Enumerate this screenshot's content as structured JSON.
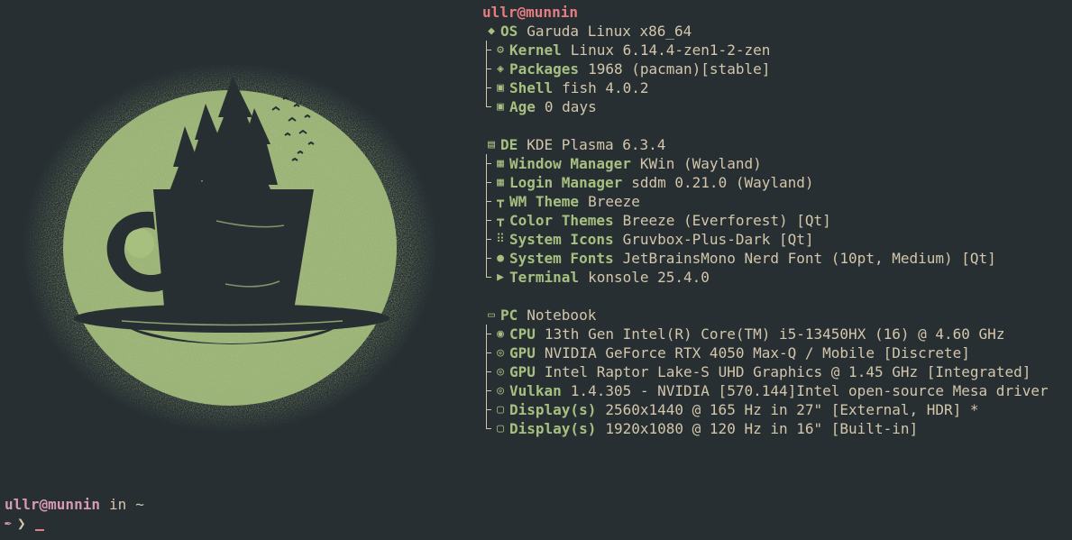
{
  "fetch": {
    "title": "ullr@munnin",
    "os_group": [
      {
        "icon": "garuda-eagle-icon",
        "key": "OS",
        "value": "Garuda Linux x86_64",
        "tree": "none"
      },
      {
        "icon": "gear-icon",
        "key": "Kernel",
        "value": "Linux 6.14.4-zen1-2-zen",
        "tree": "mid"
      },
      {
        "icon": "package-icon",
        "key": "Packages",
        "value": "1968 (pacman)[stable]",
        "tree": "mid"
      },
      {
        "icon": "terminal-prompt-icon",
        "key": "Shell",
        "value": "fish 4.0.2",
        "tree": "mid"
      },
      {
        "icon": "terminal-prompt-icon",
        "key": "Age",
        "value": "0 days",
        "tree": "end"
      }
    ],
    "de_group": [
      {
        "icon": "window-icon",
        "key": "DE",
        "value": "KDE Plasma 6.3.4",
        "tree": "none"
      },
      {
        "icon": "monitor-icon",
        "key": "Window Manager",
        "value": "KWin (Wayland)",
        "tree": "mid"
      },
      {
        "icon": "monitor-icon",
        "key": "Login Manager",
        "value": "sddm 0.21.0 (Wayland)",
        "tree": "mid"
      },
      {
        "icon": "paint-roller-icon",
        "key": "WM Theme",
        "value": "Breeze",
        "tree": "mid"
      },
      {
        "icon": "paint-roller-icon",
        "key": "Color Themes",
        "value": "Breeze (Everforest) [Qt]",
        "tree": "mid"
      },
      {
        "icon": "grid-icon",
        "key": "System Icons",
        "value": "Gruvbox-Plus-Dark [Qt]",
        "tree": "mid"
      },
      {
        "icon": "apple-icon",
        "key": "System Fonts",
        "value": "JetBrainsMono Nerd Font (10pt, Medium) [Qt]",
        "tree": "mid"
      },
      {
        "icon": "terminal-icon",
        "key": "Terminal",
        "value": "konsole 25.4.0",
        "tree": "end"
      }
    ],
    "pc_group": [
      {
        "icon": "laptop-icon",
        "key": "PC",
        "value": "Notebook",
        "tree": "none"
      },
      {
        "icon": "cpu-icon",
        "key": "CPU",
        "value": "13th Gen Intel(R) Core(TM) i5-13450HX (16) @ 4.60 GHz",
        "tree": "mid"
      },
      {
        "icon": "chip-icon",
        "key": "GPU",
        "value": "NVIDIA GeForce RTX 4050 Max-Q / Mobile [Discrete]",
        "tree": "mid"
      },
      {
        "icon": "chip-icon",
        "key": "GPU",
        "value": "Intel Raptor Lake-S UHD Graphics @ 1.45 GHz [Integrated]",
        "tree": "mid"
      },
      {
        "icon": "chip-icon",
        "key": "Vulkan",
        "value": "1.4.305 - NVIDIA [570.144]Intel open-source Mesa driver",
        "tree": "mid"
      },
      {
        "icon": "display-icon",
        "key": "Display(s)",
        "value": "2560x1440 @ 165 Hz in 27\" [External, HDR] *",
        "tree": "mid"
      },
      {
        "icon": "display-icon",
        "key": "Display(s)",
        "value": "1920x1080 @ 120 Hz in 16\" [Built-in]",
        "tree": "end"
      }
    ]
  },
  "prompt": {
    "user": "ullr@munnin",
    "in": "in",
    "path": "~",
    "arrow": "❯"
  },
  "colors": {
    "background": "#272f33",
    "accent_green": "#a7c080",
    "title_red": "#e67e80",
    "prompt_purple": "#d699b6",
    "text": "#d3c6aa"
  }
}
